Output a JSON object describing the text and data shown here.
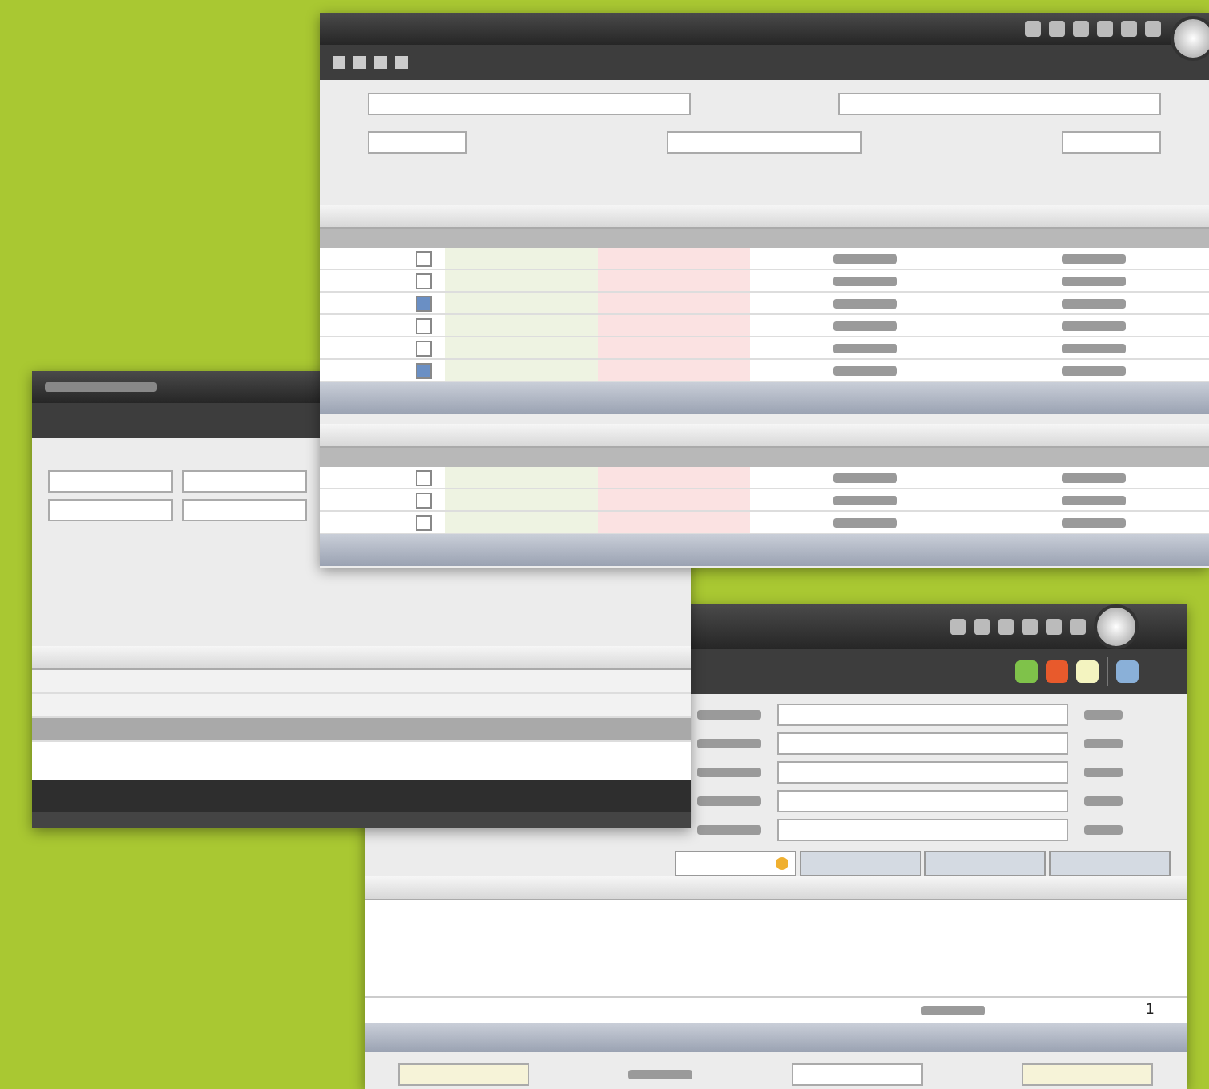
{
  "windows": [
    {
      "kind": "grid_form",
      "rows": [
        {
          "checked": false
        },
        {
          "checked": false
        },
        {
          "checked": true
        },
        {
          "checked": false
        },
        {
          "checked": false
        },
        {
          "checked": true
        }
      ],
      "lower_rows": [
        {
          "checked": false
        },
        {
          "checked": false
        },
        {
          "checked": false
        }
      ]
    },
    {
      "kind": "list",
      "rows": [
        {
          "selected": false
        },
        {
          "selected": false
        },
        {
          "selected": true
        }
      ]
    },
    {
      "kind": "entry",
      "tabs": [
        {
          "selected": true
        },
        {
          "selected": false
        },
        {
          "selected": false
        },
        {
          "selected": false
        }
      ],
      "row_number": "1"
    }
  ]
}
